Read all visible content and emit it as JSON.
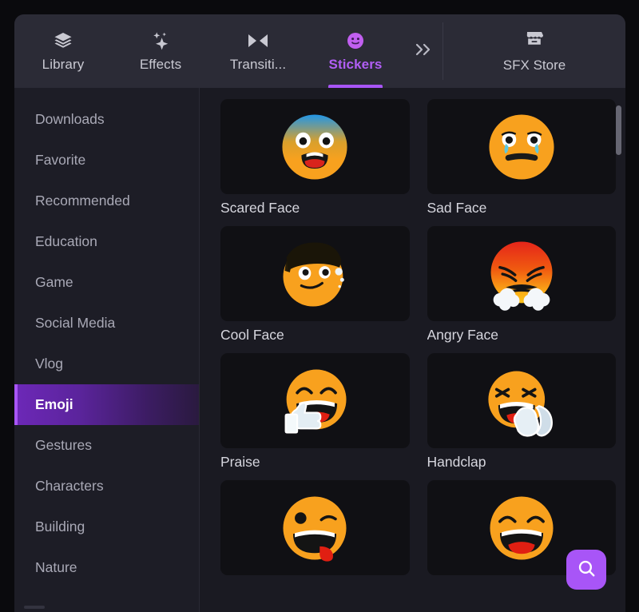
{
  "tabbar": {
    "tabs": [
      {
        "label": "Library",
        "icon": "layers-icon",
        "active": false
      },
      {
        "label": "Effects",
        "icon": "sparkles-icon",
        "active": false
      },
      {
        "label": "Transiti...",
        "icon": "transition-icon",
        "active": false
      },
      {
        "label": "Stickers",
        "icon": "smiley-icon",
        "active": true
      }
    ],
    "overflow_icon": "double-chevron-right-icon",
    "store": {
      "label": "SFX Store",
      "icon": "store-icon"
    }
  },
  "sidebar": {
    "items": [
      {
        "label": "Downloads",
        "active": false
      },
      {
        "label": "Favorite",
        "active": false
      },
      {
        "label": "Recommended",
        "active": false
      },
      {
        "label": "Education",
        "active": false
      },
      {
        "label": "Game",
        "active": false
      },
      {
        "label": "Social Media",
        "active": false
      },
      {
        "label": "Vlog",
        "active": false
      },
      {
        "label": "Emoji",
        "active": true
      },
      {
        "label": "Gestures",
        "active": false
      },
      {
        "label": "Characters",
        "active": false
      },
      {
        "label": "Building",
        "active": false
      },
      {
        "label": "Nature",
        "active": false
      }
    ]
  },
  "content": {
    "stickers": [
      {
        "label": "Scared Face",
        "art": "scared-face"
      },
      {
        "label": "Sad Face",
        "art": "sad-face"
      },
      {
        "label": "Cool Face",
        "art": "cool-face"
      },
      {
        "label": "Angry Face",
        "art": "angry-face"
      },
      {
        "label": "Praise",
        "art": "praise"
      },
      {
        "label": "Handclap",
        "art": "handclap"
      },
      {
        "label": "",
        "art": "winking-tongue-face"
      },
      {
        "label": "",
        "art": "laughing-face"
      }
    ]
  },
  "search_button": {
    "icon": "search-icon",
    "label": ""
  },
  "colors": {
    "accent": "#a855f7",
    "accent_text": "#b15ef5",
    "panel": "#1a1a22",
    "tabbar": "#2b2b36",
    "sidebar": "#1d1d26",
    "thumb_bg": "#101014",
    "emoji_yellow": "#f8a125",
    "emoji_red": "#e8241b",
    "scrollbar": "#666672"
  }
}
